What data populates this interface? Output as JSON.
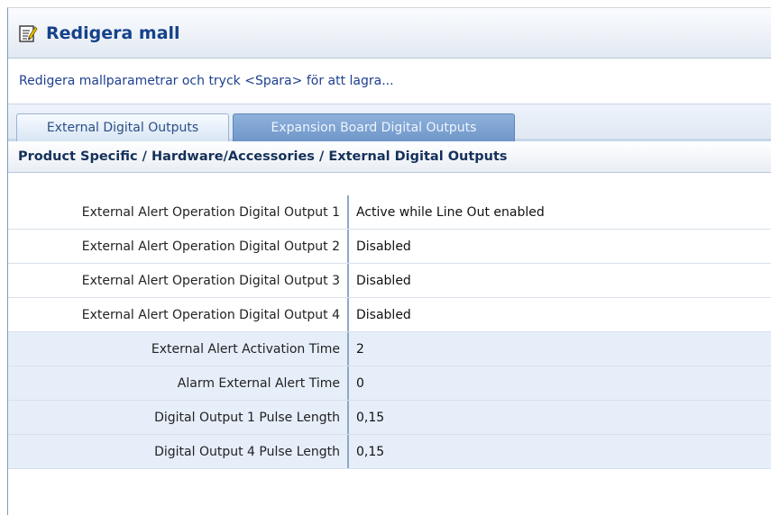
{
  "window": {
    "title": "Redigera mall",
    "icon": "edit-document-icon"
  },
  "instruction": "Redigera mallparametrar och tryck <Spara> för att lagra...",
  "tabs": [
    {
      "label": "External Digital Outputs",
      "active": true
    },
    {
      "label": "Expansion Board Digital Outputs",
      "active": false
    }
  ],
  "section_header": "Product Specific / Hardware/Accessories / External Digital Outputs",
  "rows": [
    {
      "label": "External Alert Operation Digital Output 1",
      "value": "Active while Line Out enabled"
    },
    {
      "label": "External Alert Operation Digital Output 2",
      "value": "Disabled"
    },
    {
      "label": "External Alert Operation Digital Output 3",
      "value": "Disabled"
    },
    {
      "label": "External Alert Operation Digital Output 4",
      "value": "Disabled"
    },
    {
      "label": "External Alert Activation Time",
      "value": "2"
    },
    {
      "label": "Alarm External Alert Time",
      "value": "0"
    },
    {
      "label": "Digital Output 1 Pulse Length",
      "value": "0,15"
    },
    {
      "label": "Digital Output 4 Pulse Length",
      "value": "0,15"
    }
  ],
  "colors": {
    "title": "#15428b",
    "row_shaded": "#e6eef9",
    "inactive_tab": "#7aa0d0"
  }
}
